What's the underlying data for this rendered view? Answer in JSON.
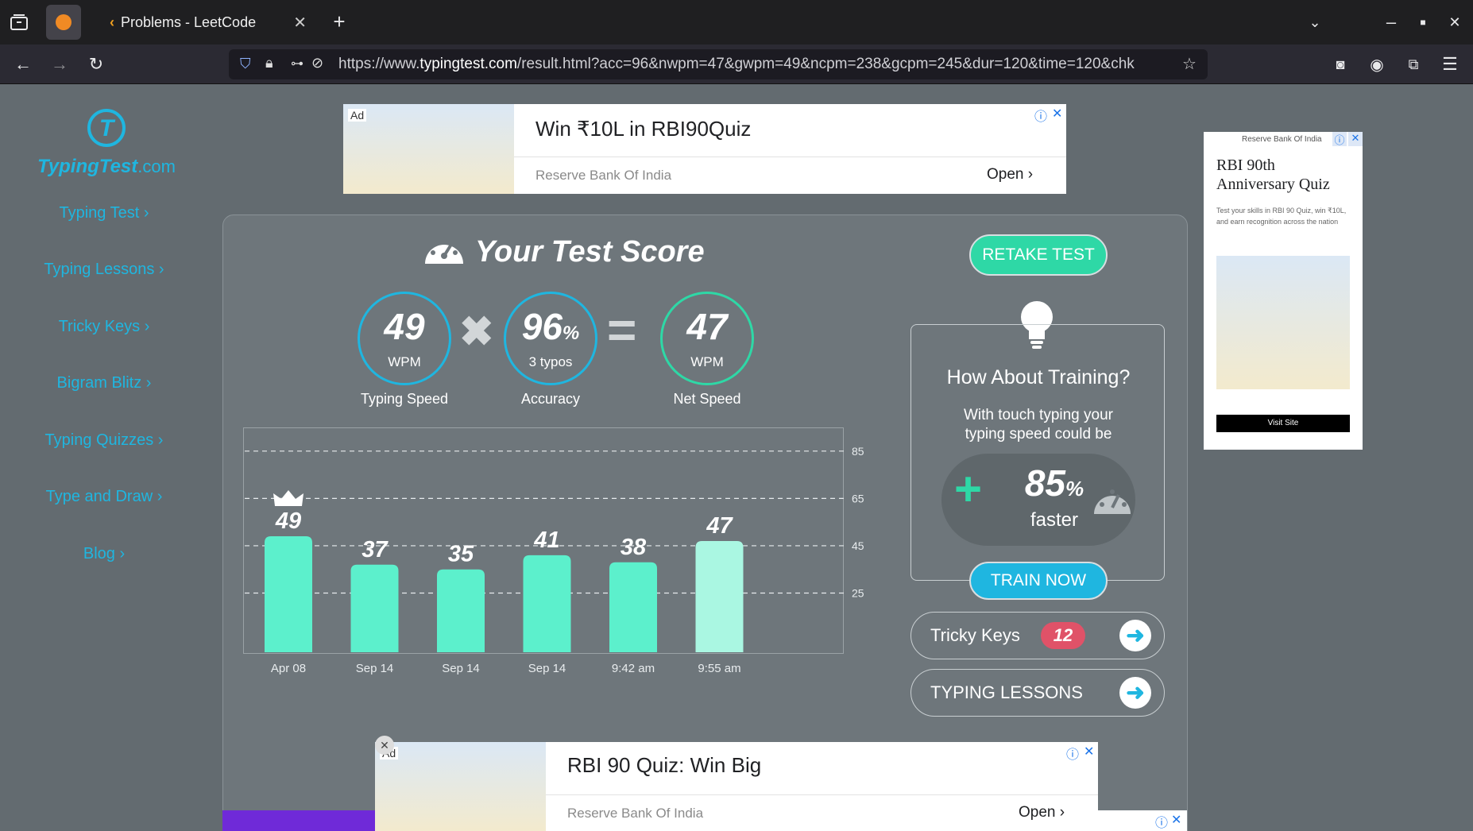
{
  "browser": {
    "tab_title": "Problems - LeetCode",
    "url_prefix": "https://www.",
    "url_domain": "typingtest.com",
    "url_rest": "/result.html?acc=96&nwpm=47&gwpm=49&ncpm=238&gcpm=245&dur=120&time=120&chk"
  },
  "sidebar": {
    "logo_main": "TypingTest",
    "logo_tld": ".com",
    "items": [
      {
        "label": "Typing Test ›"
      },
      {
        "label": "Typing Lessons ›"
      },
      {
        "label": "Tricky Keys ›"
      },
      {
        "label": "Bigram Blitz ›"
      },
      {
        "label": "Typing Quizzes ›"
      },
      {
        "label": "Type and Draw ›"
      },
      {
        "label": "Blog ›"
      }
    ]
  },
  "ad_top": {
    "badge": "Ad",
    "title": "Win ₹10L in RBI90Quiz",
    "sponsor": "Reserve Bank Of India",
    "open_label": "Open"
  },
  "ad_right": {
    "sponsor": "Reserve Bank Of India",
    "title": "RBI 90th Anniversary Quiz",
    "body": "Test your skills in RBI 90 Quiz, win ₹10L, and earn recognition across the nation",
    "cta": "Visit Site"
  },
  "score": {
    "title": "Your Test Score",
    "retake_label": "RETAKE TEST",
    "typing_speed": {
      "value": "49",
      "unit": "WPM",
      "label": "Typing Speed"
    },
    "accuracy": {
      "value": "96",
      "suffix": "%",
      "unit": "3 typos",
      "label": "Accuracy"
    },
    "net_speed": {
      "value": "47",
      "unit": "WPM",
      "label": "Net Speed"
    },
    "times_sign": "✖",
    "equals_sign": "="
  },
  "chart_data": {
    "type": "bar",
    "categories": [
      "Apr 08",
      "Sep 14",
      "Sep 14",
      "Sep 14",
      "9:42 am",
      "9:55 am"
    ],
    "values": [
      49,
      37,
      35,
      41,
      38,
      47
    ],
    "value_labels": [
      "49",
      "37",
      "35",
      "41",
      "38",
      "47"
    ],
    "ylim": [
      0,
      95
    ],
    "yticks": [
      25,
      45,
      65,
      85
    ],
    "ytick_labels": [
      "25",
      "45",
      "65",
      "85"
    ],
    "grid": true,
    "best_index": 0,
    "bar_color": "#5cf0cc",
    "latest_color": "#aaf7e2"
  },
  "training": {
    "title": "How About Training?",
    "body": "With touch typing your typing speed could be",
    "plus": "+",
    "percent": "85",
    "percent_suffix": "%",
    "faster": "faster",
    "train_label": "TRAIN NOW"
  },
  "tricky_keys": {
    "label": "Tricky Keys",
    "count": "12"
  },
  "typing_lessons": {
    "label": "TYPING LESSONS"
  },
  "ad_bottom": {
    "badge": "Ad",
    "title": "RBI 90 Quiz: Win Big",
    "sponsor": "Reserve Bank Of India",
    "open_label": "Open"
  },
  "colors": {
    "accent_blue": "#1fb6e0",
    "accent_green": "#2ed8a6",
    "badge_red": "#e05268"
  }
}
